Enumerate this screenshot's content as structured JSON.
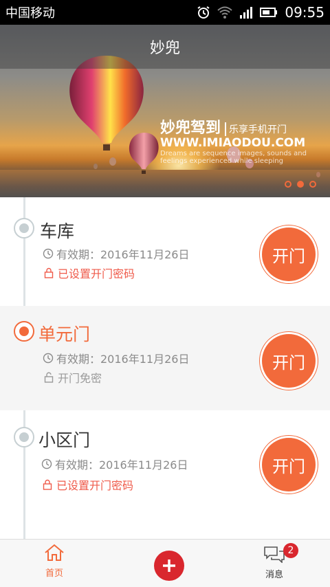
{
  "status_bar": {
    "carrier": "中国移动",
    "time": "09:55",
    "icons": [
      "alarm-icon",
      "wifi-icon",
      "signal-icon",
      "battery-icon"
    ]
  },
  "header": {
    "title": "妙兜"
  },
  "banner": {
    "slogan_main": "妙兜驾到",
    "slogan_sub": "乐享手机开门",
    "url": "WWW.IMIAODOU.COM",
    "tagline": "Dreams are sequence images, sounds and feelings experienced while sleeping",
    "slides": 3,
    "active_slide": 2
  },
  "doors": [
    {
      "name": "车库",
      "validity": "有效期：2016年11月26日",
      "password_status": "已设置开门密码",
      "password_set": true,
      "active": false,
      "button_label": "开门"
    },
    {
      "name": "单元门",
      "validity": "有效期：2016年11月26日",
      "password_status": "开门免密",
      "password_set": false,
      "active": true,
      "button_label": "开门"
    },
    {
      "name": "小区门",
      "validity": "有效期：2016年11月26日",
      "password_status": "已设置开门密码",
      "password_set": true,
      "active": false,
      "button_label": "开门"
    }
  ],
  "bottom_nav": {
    "home_label": "首页",
    "add_icon": "plus-icon",
    "message_label": "消息",
    "message_badge": "2"
  },
  "colors": {
    "accent": "#f26a3b",
    "password_set": "#ef5a4a",
    "add_button": "#d9272e"
  }
}
